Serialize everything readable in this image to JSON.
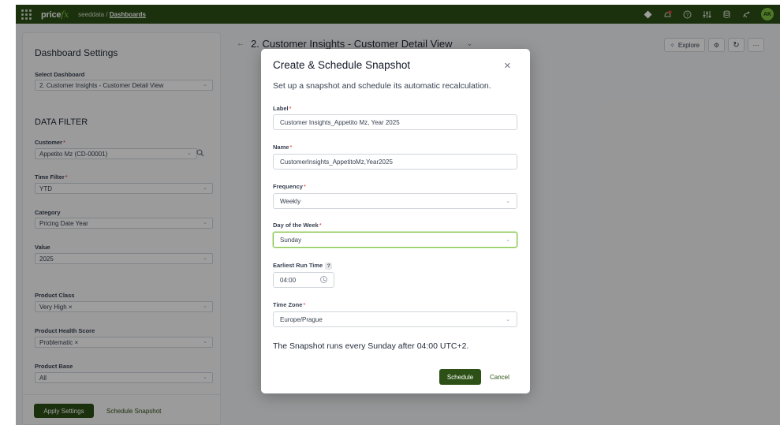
{
  "topbar": {
    "logo_main": "price",
    "logo_accent": "fx",
    "breadcrumb_prefix": "seeddata / ",
    "breadcrumb_current": "Dashboards",
    "avatar_initials": "AK"
  },
  "sidebar": {
    "title": "Dashboard Settings",
    "select_dashboard_label": "Select Dashboard",
    "select_dashboard_value": "2. Customer Insights - Customer Detail View",
    "data_filter_heading": "DATA FILTER",
    "customer_label": "Customer",
    "customer_value": "Appetito Mz (CD-00001)",
    "time_filter_label": "Time Filter",
    "time_filter_value": "YTD",
    "category_label": "Category",
    "category_value": "Pricing Date Year",
    "value_label": "Value",
    "value_value": "2025",
    "product_class_label": "Product Class",
    "product_class_value": "Very High ×",
    "product_health_label": "Product Health Score",
    "product_health_value": "Problematic ×",
    "product_base_label": "Product Base",
    "product_base_value": "All",
    "apply_button": "Apply Settings",
    "schedule_snapshot_button": "Schedule Snapshot"
  },
  "main": {
    "title": "2. Customer Insights - Customer Detail View",
    "explore_button": "Explore"
  },
  "modal": {
    "title": "Create & Schedule Snapshot",
    "subtitle": "Set up a snapshot and schedule its automatic recalculation.",
    "label_label": "Label",
    "label_value": "Customer Insights_Appetito Mz, Year 2025",
    "name_label": "Name",
    "name_value": "CustomerInsights_AppetitoMz,Year2025",
    "frequency_label": "Frequency",
    "frequency_value": "Weekly",
    "day_label": "Day of the Week",
    "day_value": "Sunday",
    "earliest_label": "Earliest Run Time",
    "earliest_help": "?",
    "earliest_value": "04:00",
    "timezone_label": "Time Zone",
    "timezone_value": "Europe/Prague",
    "summary": "The Snapshot runs every Sunday after 04:00 UTC+2.",
    "schedule_button": "Schedule",
    "cancel_button": "Cancel"
  },
  "colors": {
    "brand": "#2d5016",
    "accent": "#7fc241",
    "required": "#dc2626"
  }
}
